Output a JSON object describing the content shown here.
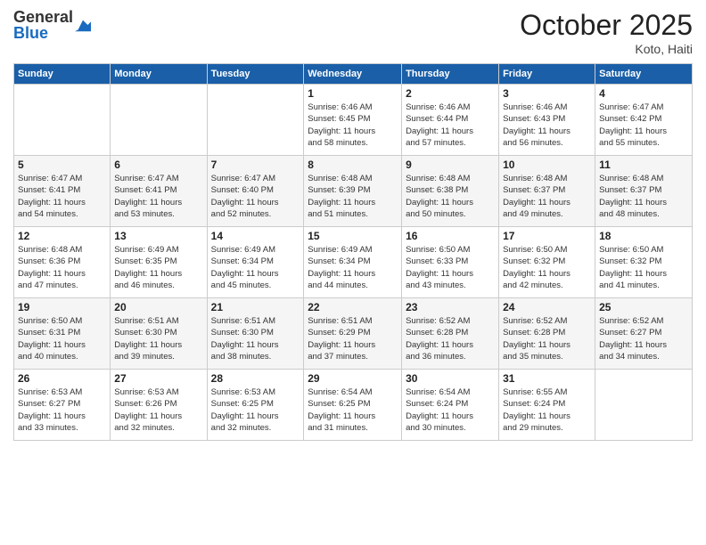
{
  "logo": {
    "general": "General",
    "blue": "Blue"
  },
  "title": "October 2025",
  "location": "Koto, Haiti",
  "days_of_week": [
    "Sunday",
    "Monday",
    "Tuesday",
    "Wednesday",
    "Thursday",
    "Friday",
    "Saturday"
  ],
  "weeks": [
    [
      {
        "day": "",
        "detail": ""
      },
      {
        "day": "",
        "detail": ""
      },
      {
        "day": "",
        "detail": ""
      },
      {
        "day": "1",
        "detail": "Sunrise: 6:46 AM\nSunset: 6:45 PM\nDaylight: 11 hours\nand 58 minutes."
      },
      {
        "day": "2",
        "detail": "Sunrise: 6:46 AM\nSunset: 6:44 PM\nDaylight: 11 hours\nand 57 minutes."
      },
      {
        "day": "3",
        "detail": "Sunrise: 6:46 AM\nSunset: 6:43 PM\nDaylight: 11 hours\nand 56 minutes."
      },
      {
        "day": "4",
        "detail": "Sunrise: 6:47 AM\nSunset: 6:42 PM\nDaylight: 11 hours\nand 55 minutes."
      }
    ],
    [
      {
        "day": "5",
        "detail": "Sunrise: 6:47 AM\nSunset: 6:41 PM\nDaylight: 11 hours\nand 54 minutes."
      },
      {
        "day": "6",
        "detail": "Sunrise: 6:47 AM\nSunset: 6:41 PM\nDaylight: 11 hours\nand 53 minutes."
      },
      {
        "day": "7",
        "detail": "Sunrise: 6:47 AM\nSunset: 6:40 PM\nDaylight: 11 hours\nand 52 minutes."
      },
      {
        "day": "8",
        "detail": "Sunrise: 6:48 AM\nSunset: 6:39 PM\nDaylight: 11 hours\nand 51 minutes."
      },
      {
        "day": "9",
        "detail": "Sunrise: 6:48 AM\nSunset: 6:38 PM\nDaylight: 11 hours\nand 50 minutes."
      },
      {
        "day": "10",
        "detail": "Sunrise: 6:48 AM\nSunset: 6:37 PM\nDaylight: 11 hours\nand 49 minutes."
      },
      {
        "day": "11",
        "detail": "Sunrise: 6:48 AM\nSunset: 6:37 PM\nDaylight: 11 hours\nand 48 minutes."
      }
    ],
    [
      {
        "day": "12",
        "detail": "Sunrise: 6:48 AM\nSunset: 6:36 PM\nDaylight: 11 hours\nand 47 minutes."
      },
      {
        "day": "13",
        "detail": "Sunrise: 6:49 AM\nSunset: 6:35 PM\nDaylight: 11 hours\nand 46 minutes."
      },
      {
        "day": "14",
        "detail": "Sunrise: 6:49 AM\nSunset: 6:34 PM\nDaylight: 11 hours\nand 45 minutes."
      },
      {
        "day": "15",
        "detail": "Sunrise: 6:49 AM\nSunset: 6:34 PM\nDaylight: 11 hours\nand 44 minutes."
      },
      {
        "day": "16",
        "detail": "Sunrise: 6:50 AM\nSunset: 6:33 PM\nDaylight: 11 hours\nand 43 minutes."
      },
      {
        "day": "17",
        "detail": "Sunrise: 6:50 AM\nSunset: 6:32 PM\nDaylight: 11 hours\nand 42 minutes."
      },
      {
        "day": "18",
        "detail": "Sunrise: 6:50 AM\nSunset: 6:32 PM\nDaylight: 11 hours\nand 41 minutes."
      }
    ],
    [
      {
        "day": "19",
        "detail": "Sunrise: 6:50 AM\nSunset: 6:31 PM\nDaylight: 11 hours\nand 40 minutes."
      },
      {
        "day": "20",
        "detail": "Sunrise: 6:51 AM\nSunset: 6:30 PM\nDaylight: 11 hours\nand 39 minutes."
      },
      {
        "day": "21",
        "detail": "Sunrise: 6:51 AM\nSunset: 6:30 PM\nDaylight: 11 hours\nand 38 minutes."
      },
      {
        "day": "22",
        "detail": "Sunrise: 6:51 AM\nSunset: 6:29 PM\nDaylight: 11 hours\nand 37 minutes."
      },
      {
        "day": "23",
        "detail": "Sunrise: 6:52 AM\nSunset: 6:28 PM\nDaylight: 11 hours\nand 36 minutes."
      },
      {
        "day": "24",
        "detail": "Sunrise: 6:52 AM\nSunset: 6:28 PM\nDaylight: 11 hours\nand 35 minutes."
      },
      {
        "day": "25",
        "detail": "Sunrise: 6:52 AM\nSunset: 6:27 PM\nDaylight: 11 hours\nand 34 minutes."
      }
    ],
    [
      {
        "day": "26",
        "detail": "Sunrise: 6:53 AM\nSunset: 6:27 PM\nDaylight: 11 hours\nand 33 minutes."
      },
      {
        "day": "27",
        "detail": "Sunrise: 6:53 AM\nSunset: 6:26 PM\nDaylight: 11 hours\nand 32 minutes."
      },
      {
        "day": "28",
        "detail": "Sunrise: 6:53 AM\nSunset: 6:25 PM\nDaylight: 11 hours\nand 32 minutes."
      },
      {
        "day": "29",
        "detail": "Sunrise: 6:54 AM\nSunset: 6:25 PM\nDaylight: 11 hours\nand 31 minutes."
      },
      {
        "day": "30",
        "detail": "Sunrise: 6:54 AM\nSunset: 6:24 PM\nDaylight: 11 hours\nand 30 minutes."
      },
      {
        "day": "31",
        "detail": "Sunrise: 6:55 AM\nSunset: 6:24 PM\nDaylight: 11 hours\nand 29 minutes."
      },
      {
        "day": "",
        "detail": ""
      }
    ]
  ]
}
